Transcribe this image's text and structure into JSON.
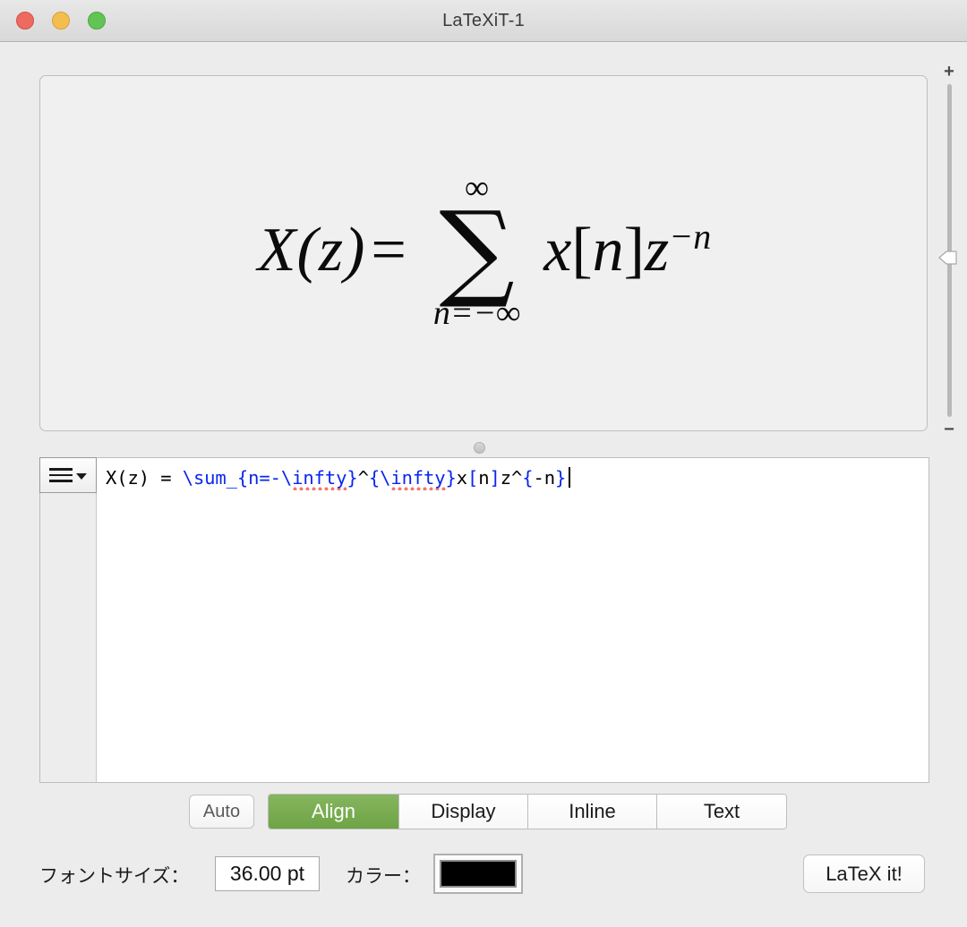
{
  "window": {
    "title": "LaTeXiT-1",
    "traffic_lights": [
      {
        "name": "close",
        "color": "#ed6a5e"
      },
      {
        "name": "minimize",
        "color": "#f4bd4f"
      },
      {
        "name": "zoom",
        "color": "#61c454"
      }
    ]
  },
  "preview": {
    "equation_latex": "X(z) = \\sum_{n=-\\infty}^{\\infty}x[n]z^{-n}",
    "lhs": "X(z)",
    "equals": "=",
    "sum_upper_limit": "∞",
    "sum_glyph": "∑",
    "sum_lower_limit": "n=−∞",
    "rhs_x": "x",
    "rhs_open_bracket": "[",
    "rhs_n": "n",
    "rhs_close_bracket": "]",
    "rhs_z": "z",
    "rhs_exponent": "−n",
    "background_color": "#f0f0f0"
  },
  "zoom_slider": {
    "plus_label": "+",
    "minus_label": "−",
    "thumb_position_percent": 49
  },
  "editor": {
    "menu_icon": "hamburger-menu-icon",
    "caret_visible": true,
    "tokens": [
      {
        "text": "X(z) = ",
        "style": "plain"
      },
      {
        "text": "\\sum_{n=-\\",
        "style": "command"
      },
      {
        "text": "infty",
        "style": "misspelled-command"
      },
      {
        "text": "}",
        "style": "command"
      },
      {
        "text": "^",
        "style": "plain"
      },
      {
        "text": "{\\",
        "style": "command"
      },
      {
        "text": "infty",
        "style": "misspelled-command"
      },
      {
        "text": "}",
        "style": "command"
      },
      {
        "text": "x",
        "style": "plain"
      },
      {
        "text": "[",
        "style": "command"
      },
      {
        "text": "n",
        "style": "plain"
      },
      {
        "text": "]",
        "style": "command"
      },
      {
        "text": "z^",
        "style": "plain"
      },
      {
        "text": "{",
        "style": "command"
      },
      {
        "text": "-n",
        "style": "plain"
      },
      {
        "text": "}",
        "style": "command"
      },
      {
        "text": " ",
        "style": "plain"
      }
    ],
    "command_color": "#0a26ef",
    "plain_color": "#000000",
    "spellcheck_underline_color": "#f2786e"
  },
  "modes": {
    "auto_label": "Auto",
    "segments": [
      {
        "label": "Align",
        "selected": true
      },
      {
        "label": "Display",
        "selected": false
      },
      {
        "label": "Inline",
        "selected": false
      },
      {
        "label": "Text",
        "selected": false
      }
    ],
    "selected_color": "#6ea445"
  },
  "bottom_bar": {
    "fontsize_label": "フォントサイズ：",
    "fontsize_value": "36.00 pt",
    "color_label": "カラー：",
    "color_value": "#000000",
    "latexit_button": "LaTeX it!"
  }
}
